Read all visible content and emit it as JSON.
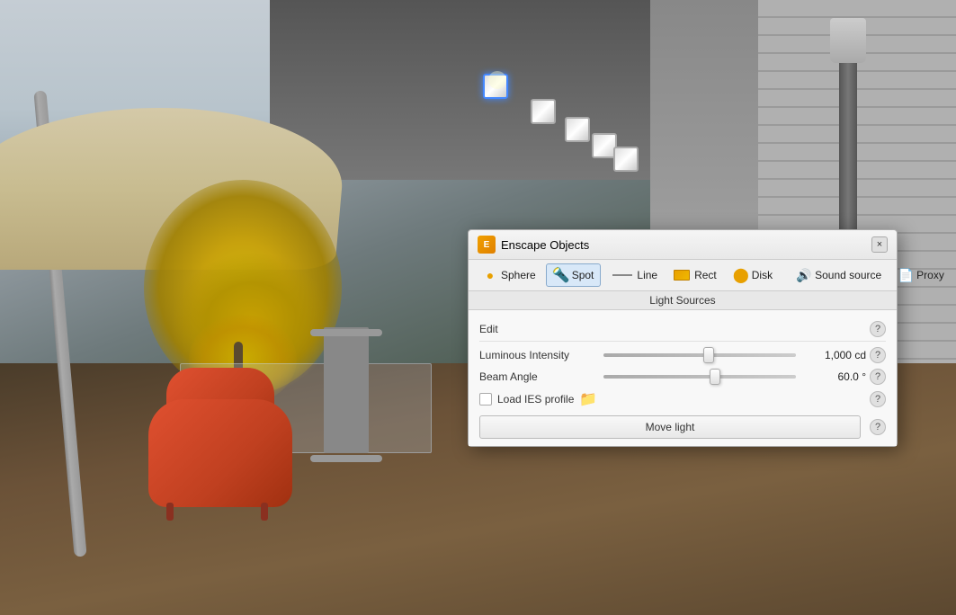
{
  "scene": {
    "background": "architectural outdoor scene with umbrella, chair, tree, ceiling lights"
  },
  "dialog": {
    "title": "Enscape Objects",
    "close_label": "×",
    "logo_label": "E",
    "toolbar": {
      "sphere_label": "Sphere",
      "spot_label": "Spot",
      "line_label": "Line",
      "rect_label": "Rect",
      "disk_label": "Disk",
      "sound_source_label": "Sound source",
      "proxy_label": "Proxy"
    },
    "section_heading": "Light Sources",
    "edit_label": "Edit",
    "luminous_intensity_label": "Luminous Intensity",
    "luminous_intensity_value": "1,000 cd",
    "luminous_intensity_slider_pos": 52,
    "beam_angle_label": "Beam Angle",
    "beam_angle_value": "60.0 °",
    "beam_angle_slider_pos": 55,
    "ies_checkbox_label": "Load IES profile",
    "move_light_label": "Move light",
    "help_tooltip": "?"
  }
}
